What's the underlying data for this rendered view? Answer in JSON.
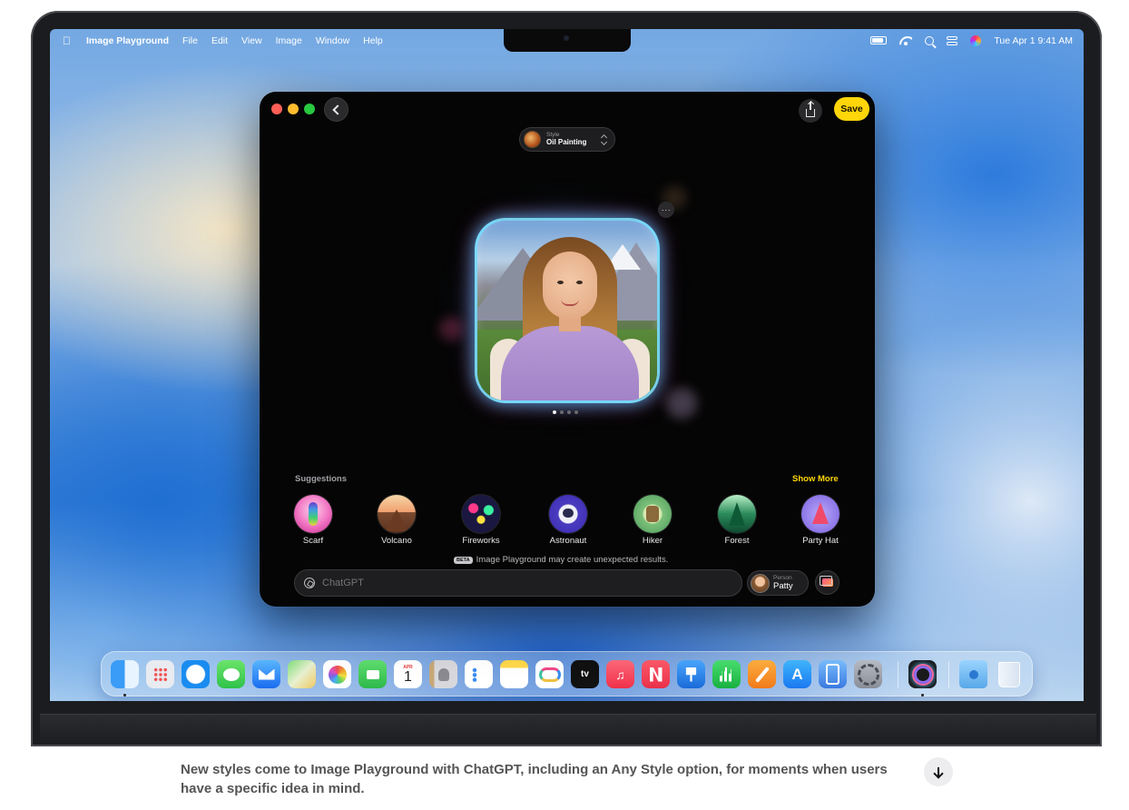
{
  "menubar": {
    "apple_icon": "apple-logo-icon",
    "app_name": "Image Playground",
    "menus": [
      "File",
      "Edit",
      "View",
      "Image",
      "Window",
      "Help"
    ],
    "status_icons": [
      "battery-icon",
      "wifi-icon",
      "spotlight-icon",
      "control-center-icon",
      "siri-icon"
    ],
    "clock": "Tue Apr 1  9:41 AM"
  },
  "window": {
    "save_label": "Save",
    "style_picker": {
      "caption": "Style",
      "value": "Oil Painting"
    },
    "more_label": "···",
    "page_count": 4,
    "active_page": 1,
    "suggestions_title": "Suggestions",
    "show_more_label": "Show More",
    "suggestions": [
      {
        "label": "Scarf",
        "icon": "scarf-icon"
      },
      {
        "label": "Volcano",
        "icon": "volcano-icon"
      },
      {
        "label": "Fireworks",
        "icon": "fireworks-icon"
      },
      {
        "label": "Astronaut",
        "icon": "astronaut-icon"
      },
      {
        "label": "Hiker",
        "icon": "hiker-icon"
      },
      {
        "label": "Forest",
        "icon": "forest-icon"
      },
      {
        "label": "Party Hat",
        "icon": "party-hat-icon"
      }
    ],
    "beta_badge": "BETA",
    "beta_notice": "Image Playground may create unexpected results.",
    "prompt_placeholder": "ChatGPT",
    "person": {
      "caption": "Person",
      "name": "Patty"
    }
  },
  "dock": {
    "items": [
      "Finder",
      "Launchpad",
      "Safari",
      "Messages",
      "Mail",
      "Maps",
      "Photos",
      "FaceTime",
      "Calendar",
      "Contacts",
      "Reminders",
      "Notes",
      "Freeform",
      "TV",
      "Music",
      "News",
      "Keynote",
      "Numbers",
      "Pages",
      "App Store",
      "iPhone Mirroring",
      "System Settings",
      "Image Playground",
      "Downloads",
      "Trash"
    ],
    "calendar_month": "APR",
    "calendar_day": "1",
    "tv_label": "tv",
    "appstore_glyph": "A"
  },
  "caption": {
    "text": "New styles come to Image Playground with ChatGPT, including an Any Style option, for moments when users have a specific idea in mind."
  }
}
